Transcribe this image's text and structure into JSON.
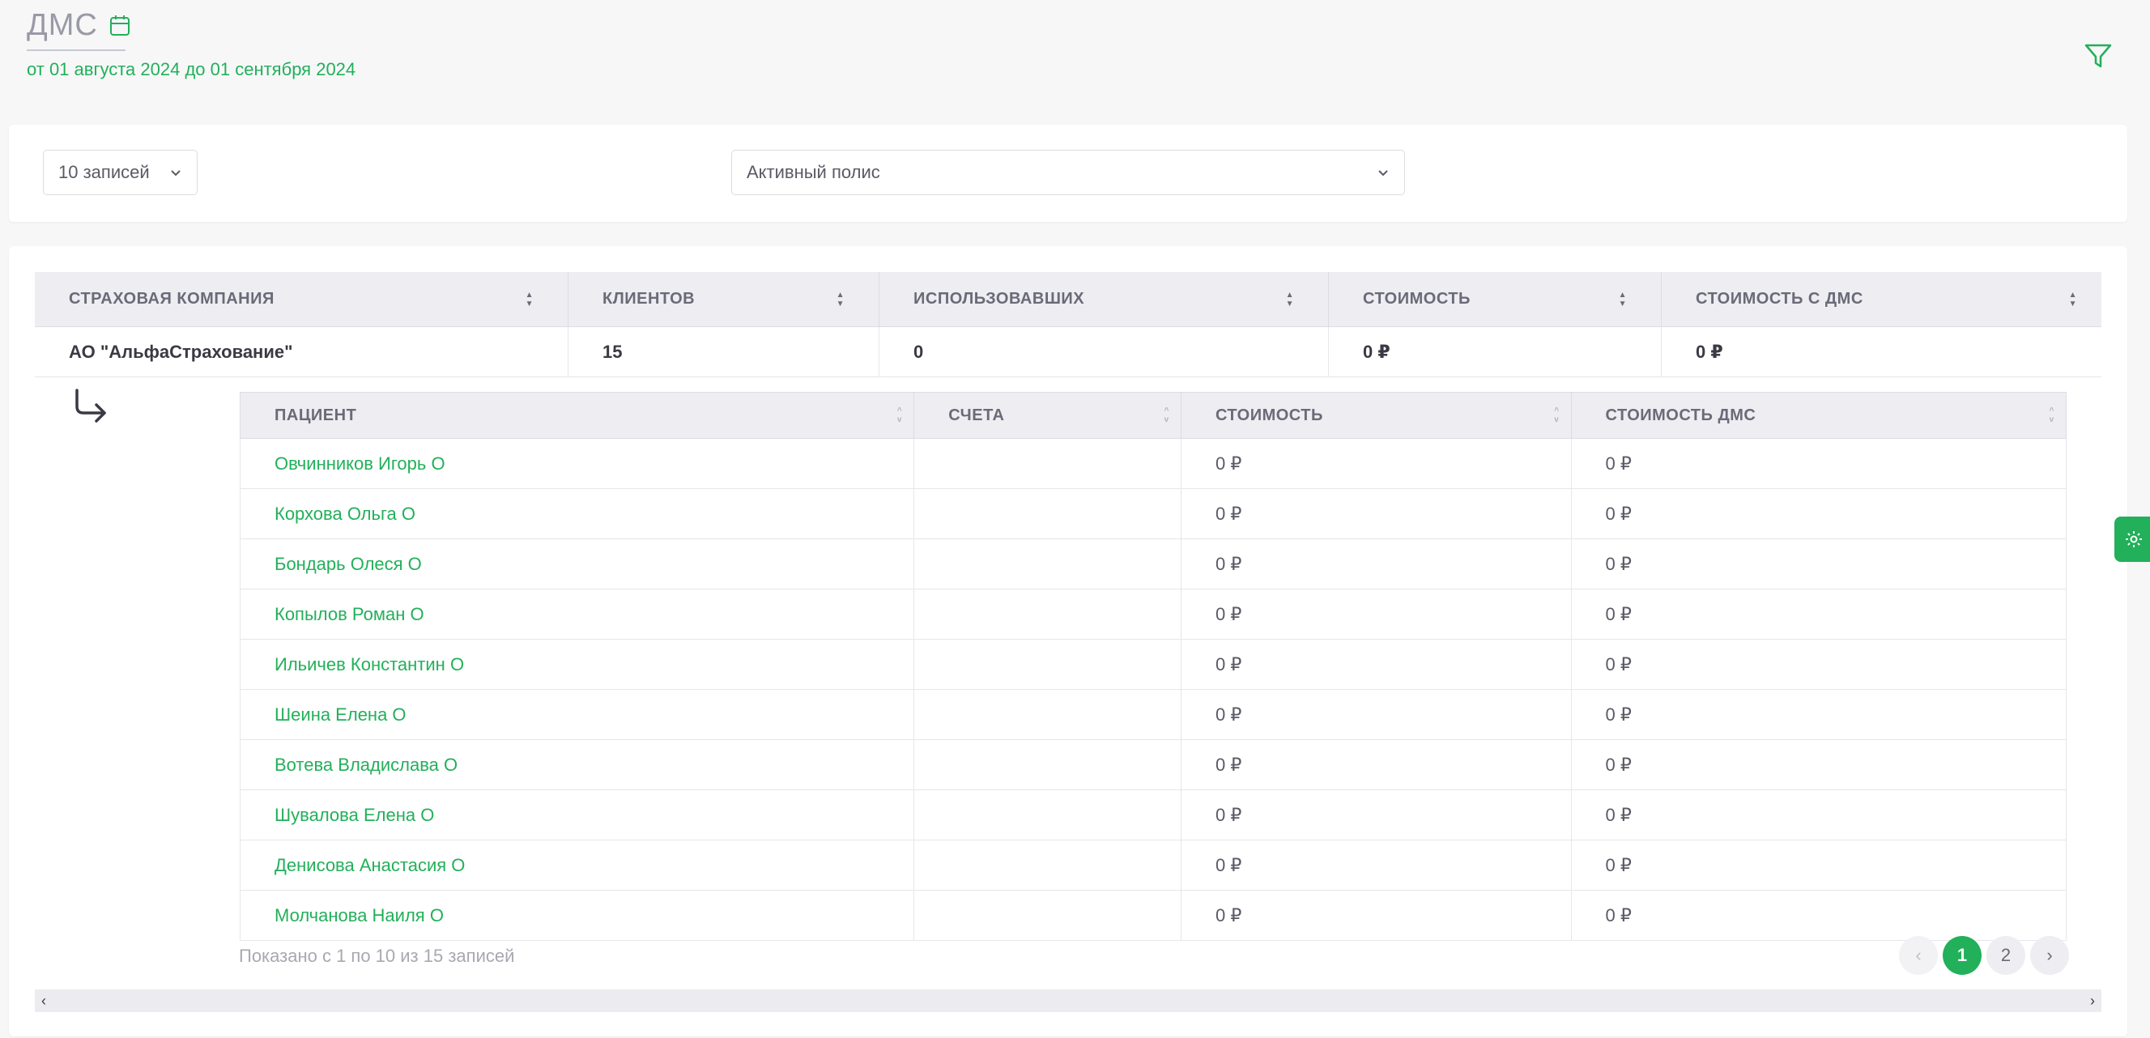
{
  "header": {
    "title": "ДМС",
    "date_range": "от 01 августа 2024 до 01 сентября 2024"
  },
  "controls": {
    "records_select": "10 записей",
    "policy_select": "Активный полис"
  },
  "outer_table": {
    "columns": [
      "СТРАХОВАЯ КОМПАНИЯ",
      "КЛИЕНТОВ",
      "ИСПОЛЬЗОВАВШИХ",
      "СТОИМОСТЬ",
      "СТОИМОСТЬ С ДМС"
    ],
    "rows": [
      [
        "АО \"АльфаСтрахование\"",
        "15",
        "0",
        "0 ₽",
        "0 ₽"
      ]
    ]
  },
  "inner_table": {
    "columns": [
      "ПАЦИЕНТ",
      "СЧЕТА",
      "СТОИМОСТЬ",
      "СТОИМОСТЬ ДМС"
    ],
    "rows": [
      [
        "Овчинников Игорь О",
        "",
        "0 ₽",
        "0 ₽"
      ],
      [
        "Корхова Ольга О",
        "",
        "0 ₽",
        "0 ₽"
      ],
      [
        "Бондарь Олеся О",
        "",
        "0 ₽",
        "0 ₽"
      ],
      [
        "Копылов Роман О",
        "",
        "0 ₽",
        "0 ₽"
      ],
      [
        "Ильичев Константин О",
        "",
        "0 ₽",
        "0 ₽"
      ],
      [
        "Шеина Елена О",
        "",
        "0 ₽",
        "0 ₽"
      ],
      [
        "Вотева Владислава О",
        "",
        "0 ₽",
        "0 ₽"
      ],
      [
        "Шувалова Елена О",
        "",
        "0 ₽",
        "0 ₽"
      ],
      [
        "Денисова Анастасия О",
        "",
        "0 ₽",
        "0 ₽"
      ],
      [
        "Молчанова Наиля О",
        "",
        "0 ₽",
        "0 ₽"
      ]
    ],
    "footer_info": "Показано с 1 по 10 из 15 записей",
    "pages": [
      "1",
      "2"
    ],
    "current_page": "1"
  },
  "colors": {
    "accent": "#22b05a",
    "header_bg": "#ededf2",
    "page_bg": "#f7f7f8"
  },
  "icons": {
    "calendar": "calendar-icon",
    "filter": "filter-icon",
    "return": "return-arrow-icon",
    "settings": "gear-icon"
  }
}
